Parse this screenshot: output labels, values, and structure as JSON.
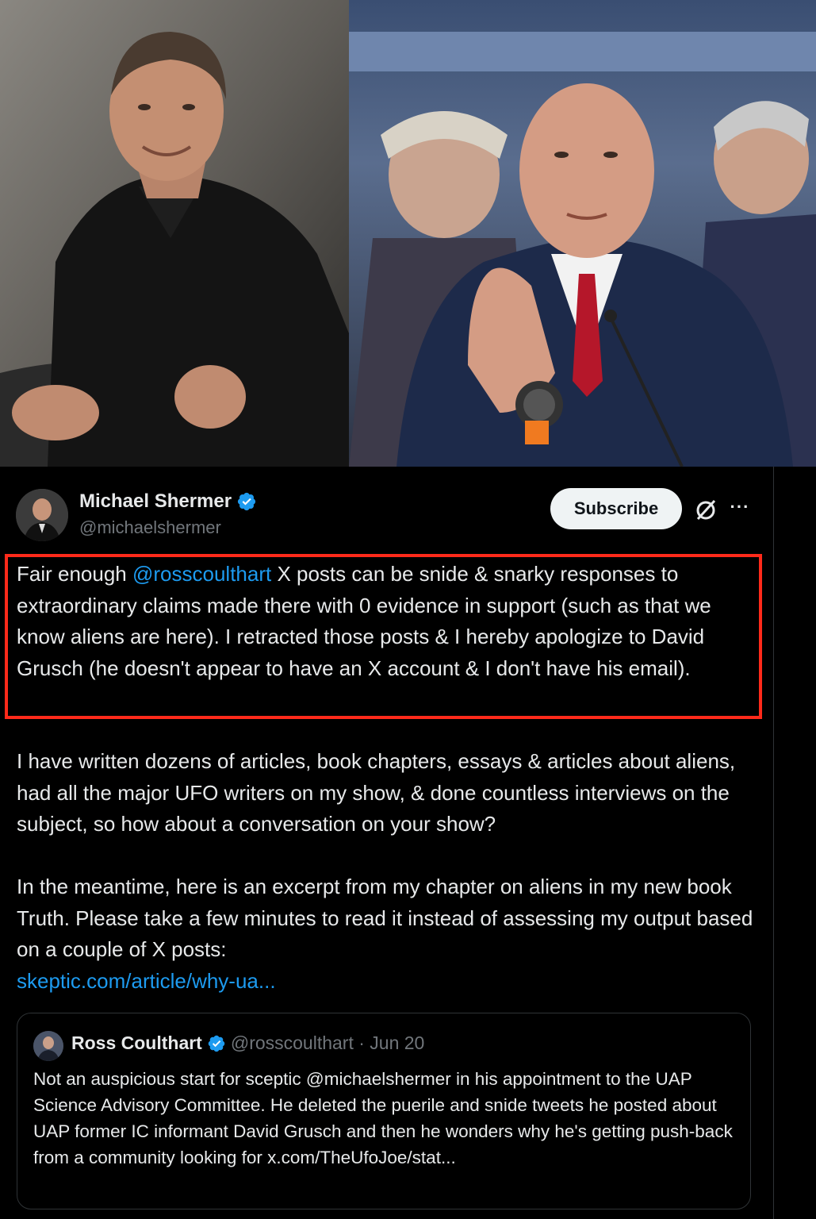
{
  "photos": {
    "left_alt": "Portrait of Michael Shermer",
    "right_alt": "David Grusch testifying at hearing"
  },
  "tweet": {
    "author_name": "Michael Shermer",
    "author_handle": "@michaelshermer",
    "subscribe_label": "Subscribe",
    "more_label": "···",
    "p1_before": "Fair enough ",
    "p1_mention": "@rosscoulthart",
    "p1_after": " X posts can be snide & snarky responses to extraordinary claims made there with 0 evidence in support (such as that we know aliens are here). I retracted those posts & I hereby apologize to David Grusch (he doesn't appear to have an X account & I don't have his email).",
    "p2": "I have written dozens of articles, book chapters, essays & articles about aliens, had all the major UFO writers on my show, & done countless interviews on the subject, so how about a conversation on your show?",
    "p3": "In the meantime, here is an excerpt from my chapter on aliens in my new book Truth. Please take a few minutes to read it instead of assessing my output based on a couple of X posts:",
    "link": "skeptic.com/article/why-ua..."
  },
  "quote": {
    "author_name": "Ross Coulthart",
    "author_handle": "@rosscoulthart · Jun 20",
    "text": "Not an auspicious start for sceptic @michaelshermer in his appointment to the UAP Science Advisory Committee. He deleted the puerile and snide tweets he posted about UAP former IC informant David Grusch and then he wonders why he's getting push-back from a community looking for x.com/TheUfoJoe/stat..."
  },
  "colors": {
    "accent": "#1d9bf0",
    "highlight_border": "#ff2a1a",
    "background": "#000000"
  }
}
